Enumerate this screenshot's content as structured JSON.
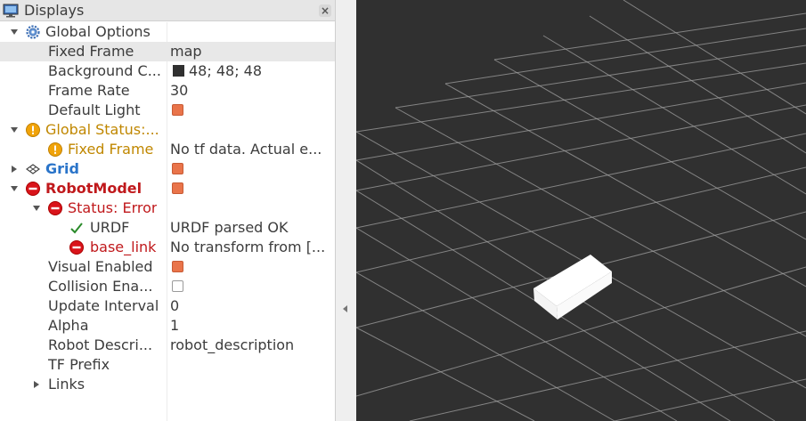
{
  "panel": {
    "title": "Displays",
    "close_icon": "close-icon"
  },
  "tree": {
    "global_options": {
      "label": "Global Options",
      "fixed_frame": {
        "name": "Fixed Frame",
        "value": "map"
      },
      "background_color": {
        "name": "Background C...",
        "value": "48; 48; 48",
        "color": "#303030"
      },
      "frame_rate": {
        "name": "Frame Rate",
        "value": "30"
      },
      "default_light": {
        "name": "Default Light",
        "checked": true
      }
    },
    "global_status": {
      "label": "Global Status:...",
      "fixed_frame": {
        "name": "Fixed Frame",
        "value": "No tf data.  Actual e..."
      }
    },
    "grid": {
      "label": "Grid",
      "checked": true
    },
    "robot_model": {
      "label": "RobotModel",
      "checked": true,
      "status": {
        "label": "Status: Error",
        "urdf": {
          "name": "URDF",
          "value": "URDF parsed OK"
        },
        "base_link": {
          "name": "base_link",
          "value": "No transform from [..."
        }
      },
      "visual_enabled": {
        "name": "Visual Enabled",
        "checked": true
      },
      "collision_enabled": {
        "name": "Collision Ena...",
        "checked": false
      },
      "update_interval": {
        "name": "Update Interval",
        "value": "0"
      },
      "alpha": {
        "name": "Alpha",
        "value": "1"
      },
      "robot_description": {
        "name": "Robot Descri...",
        "value": "robot_description"
      },
      "tf_prefix": {
        "name": "TF Prefix",
        "value": ""
      },
      "links": {
        "name": "Links"
      }
    }
  },
  "colors": {
    "checkbox_checked": "#e9744a",
    "warning": "#c08700",
    "error": "#c0191c",
    "grid_link": "#2a74c9",
    "viewport_background": "#303030",
    "grid_lines": "#a0a0a0",
    "ok_check": "#2a8a2a"
  }
}
